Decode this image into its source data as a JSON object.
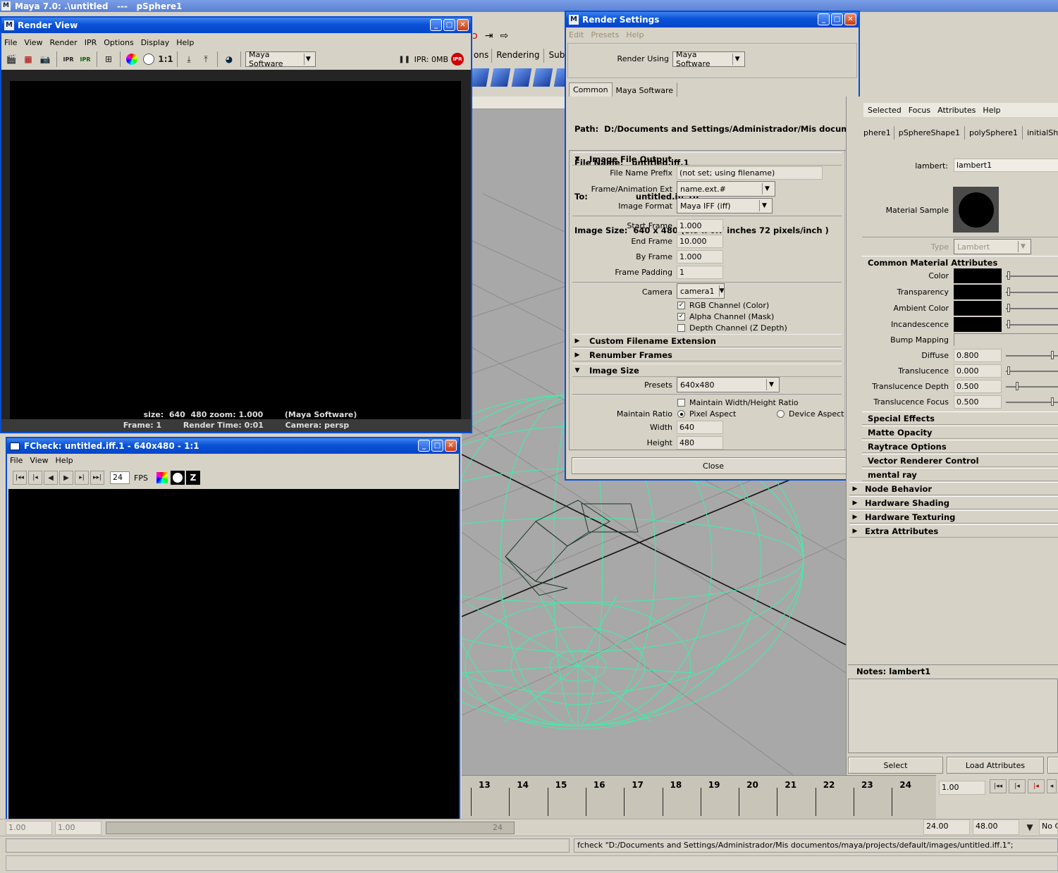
{
  "main_title": "Maya 7.0: .\\untitled   ---   pSphere1",
  "shelf_tabs": [
    "ons",
    "Rendering",
    "Subdivs"
  ],
  "render_view": {
    "title": "Render View",
    "menu": [
      "File",
      "View",
      "Render",
      "IPR",
      "Options",
      "Display",
      "Help"
    ],
    "ratio_label": "1:1",
    "renderer": "Maya Software",
    "ipr_status": "IPR: 0MB",
    "ipr_badge": "IPR",
    "status1": "size:  640  480 zoom: 1.000        (Maya Software)",
    "status2": "Frame: 1        Render Time: 0:01        Camera: persp"
  },
  "fcheck": {
    "title": "FCheck: untitled.iff.1 - 640x480 - 1:1",
    "menu": [
      "File",
      "View",
      "Help"
    ],
    "fps_value": "24",
    "fps_label": "FPS",
    "z_label": "Z"
  },
  "render_settings": {
    "title": "Render Settings",
    "menu": [
      "Edit",
      "Presets",
      "Help"
    ],
    "render_using_label": "Render Using",
    "render_using_value": "Maya Software",
    "tabs": [
      "Common",
      "Maya Software"
    ],
    "path": "Path:  D:/Documents and Settings/Administrador/Mis documentos/may",
    "file_name": "File Name:   untitled.iff.1",
    "to": "To:                 untitled.iff.10",
    "image_size": "Image Size:  640 x 480 (8.9 x 6.7 inches 72 pixels/inch )",
    "sections": {
      "image_file_output": "Image File Output",
      "custom_filename": "Custom Filename Extension",
      "renumber_frames": "Renumber Frames",
      "image_size": "Image Size"
    },
    "file_name_prefix_label": "File Name Prefix",
    "file_name_prefix_value": "(not set; using filename)",
    "frame_ext_label": "Frame/Animation Ext",
    "frame_ext_value": "name.ext.#",
    "image_format_label": "Image Format",
    "image_format_value": "Maya IFF (iff)",
    "start_frame_label": "Start Frame",
    "start_frame_value": "1.000",
    "end_frame_label": "End Frame",
    "end_frame_value": "10.000",
    "by_frame_label": "By Frame",
    "by_frame_value": "1.000",
    "frame_padding_label": "Frame Padding",
    "frame_padding_value": "1",
    "camera_label": "Camera",
    "camera_value": "camera1",
    "rgb_channel": "RGB Channel (Color)",
    "alpha_channel": "Alpha Channel (Mask)",
    "depth_channel": "Depth Channel (Z Depth)",
    "presets_label": "Presets",
    "presets_value": "640x480",
    "maintain_wh": "Maintain Width/Height Ratio",
    "maintain_ratio_label": "Maintain Ratio",
    "pixel_aspect": "Pixel Aspect",
    "device_aspect": "Device Aspect",
    "width_label": "Width",
    "width_value": "640",
    "height_label": "Height",
    "height_value": "480",
    "close_label": "Close"
  },
  "attribute_editor": {
    "menu": [
      "Selected",
      "Focus",
      "Attributes",
      "Help"
    ],
    "node_tabs": [
      "phere1",
      "pSphereShape1",
      "polySphere1",
      "initialShadingGr"
    ],
    "lambert_label": "lambert:",
    "lambert_value": "lambert1",
    "material_sample_label": "Material Sample",
    "type_label": "Type",
    "type_value": "Lambert",
    "common_header": "Common Material Attributes",
    "color_attrs": [
      "Color",
      "Transparency",
      "Ambient Color",
      "Incandescence"
    ],
    "bump_label": "Bump Mapping",
    "diffuse_label": "Diffuse",
    "diffuse_value": "0.800",
    "translucence_label": "Translucence",
    "translucence_value": "0.000",
    "translucence_depth_label": "Translucence Depth",
    "translucence_depth_value": "0.500",
    "translucence_focus_label": "Translucence Focus",
    "translucence_focus_value": "0.500",
    "closed_sections": [
      "Special Effects",
      "Matte Opacity",
      "Raytrace Options",
      "Vector Renderer Control",
      "mental ray"
    ],
    "arrow_sections": [
      "Node Behavior",
      "Hardware Shading",
      "Hardware Texturing",
      "Extra Attributes"
    ],
    "notes_label": "Notes:  lambert1",
    "select_button": "Select",
    "load_attributes_button": "Load Attributes"
  },
  "timeline": {
    "frames": [
      "13",
      "14",
      "15",
      "16",
      "17",
      "18",
      "19",
      "20",
      "21",
      "22",
      "23",
      "24"
    ],
    "current_frame": "1.00",
    "range_end": "24.00",
    "range_max": "48.00",
    "range_mid": "24",
    "no_char": "No C",
    "left_start_a": "1.00",
    "left_start_b": "1.00"
  },
  "command_line": "fcheck \"D:/Documents and Settings/Administrador/Mis documentos/maya/projects/default/images/untitled.iff.1\";",
  "colors": {
    "wire": "#3cf0a8",
    "xp_blue": "#0a52d6",
    "panel": "#d6d2c6",
    "viewport": "#a8a8a8"
  }
}
